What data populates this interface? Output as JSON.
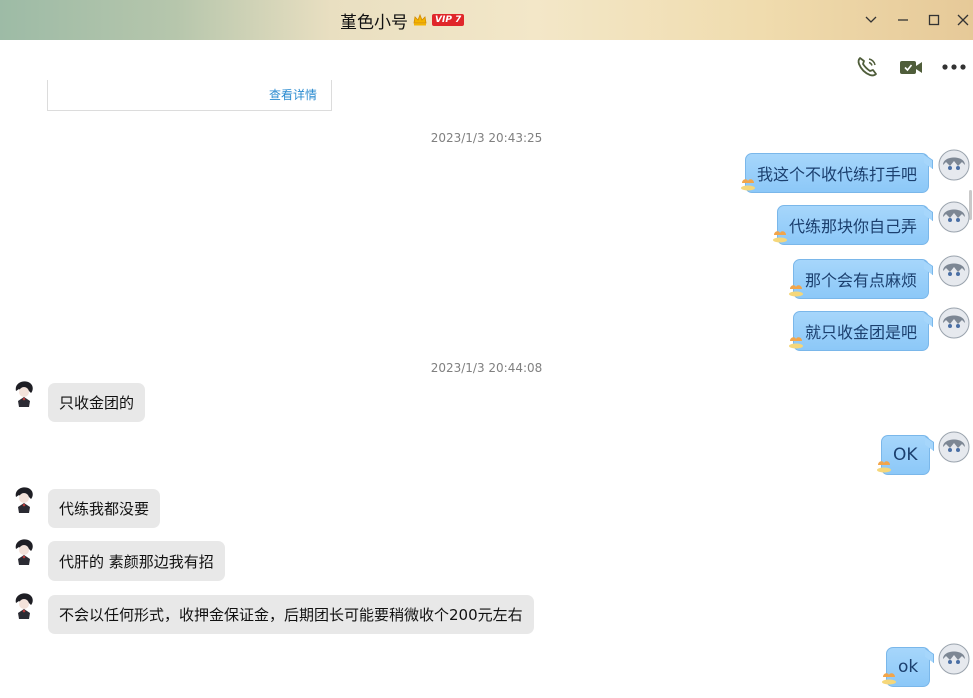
{
  "window": {
    "title": "堇色小号",
    "vip_label": "VIP 7",
    "controls": [
      "chevron-down-icon",
      "minimize-icon",
      "maximize-icon",
      "close-icon"
    ]
  },
  "toolbar": [
    "phone-icon",
    "video-call-icon",
    "more-icon"
  ],
  "card": {
    "link_text": "查看详情"
  },
  "timestamps": [
    "2023/1/3 20:43:25",
    "2023/1/3 20:44:08"
  ],
  "messages": [
    {
      "side": "out",
      "text": "我这个不收代练打手吧"
    },
    {
      "side": "out",
      "text": "代练那块你自己弄"
    },
    {
      "side": "out",
      "text": "那个会有点麻烦"
    },
    {
      "side": "out",
      "text": "就只收金团是吧"
    },
    {
      "side": "in",
      "text": "只收金团的"
    },
    {
      "side": "out",
      "text": "OK"
    },
    {
      "side": "in",
      "text": "代练我都没要"
    },
    {
      "side": "in",
      "text": "代肝的 素颜那边我有招"
    },
    {
      "side": "in",
      "text": "不会以任何形式，收押金保证金，后期团长可能要稍微收个200元左右"
    },
    {
      "side": "out",
      "text": "ok"
    }
  ],
  "colors": {
    "bubble_out": "#a6d6fb",
    "bubble_in": "#e8e8e8",
    "link": "#2a8bd0",
    "vip_badge": "#e0262a"
  }
}
